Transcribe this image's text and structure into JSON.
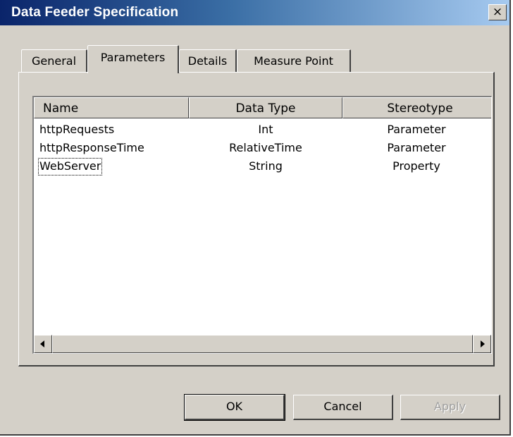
{
  "window": {
    "title": "Data Feeder Specification",
    "close_label": "×"
  },
  "tabs": [
    {
      "label": "General",
      "active": false
    },
    {
      "label": "Parameters",
      "active": true
    },
    {
      "label": "Details",
      "active": false
    },
    {
      "label": "Measure Point",
      "active": false
    }
  ],
  "table": {
    "columns": [
      "Name",
      "Data Type",
      "Stereotype"
    ],
    "rows": [
      {
        "name": "httpRequests",
        "data_type": "Int",
        "stereotype": "Parameter"
      },
      {
        "name": "httpResponseTime",
        "data_type": "RelativeTime",
        "stereotype": "Parameter"
      },
      {
        "name": "WebServer",
        "data_type": "String",
        "stereotype": "Property",
        "focused": true
      }
    ]
  },
  "buttons": {
    "ok": "OK",
    "cancel": "Cancel",
    "apply": "Apply"
  },
  "colors": {
    "title_gradient_start": "#0a246a",
    "title_gradient_end": "#a6caf0",
    "face": "#d4d0c8"
  }
}
